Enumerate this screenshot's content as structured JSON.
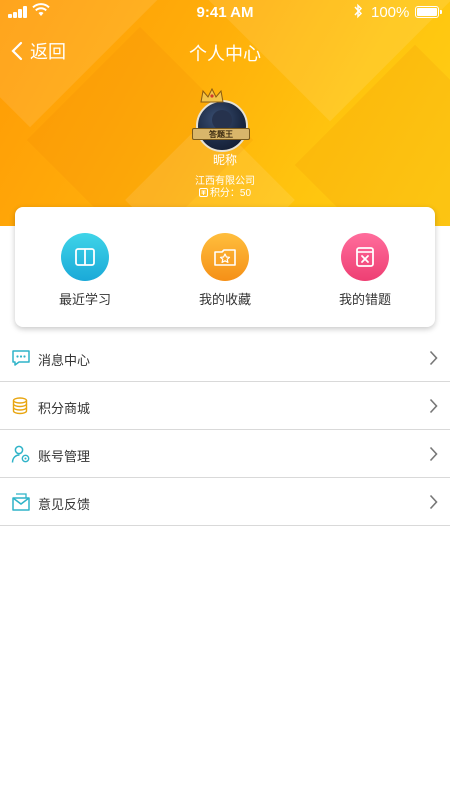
{
  "status_bar": {
    "time": "9:41 AM",
    "battery": "100%"
  },
  "nav": {
    "back_label": "返回",
    "title": "个人中心"
  },
  "profile": {
    "badge_text": "答题王",
    "nickname": "昵称",
    "company": "江西有限公司",
    "points_text": "积分：50"
  },
  "quick_actions": [
    {
      "label": "最近学习",
      "icon": "book-icon",
      "color": "#27bde0"
    },
    {
      "label": "我的收藏",
      "icon": "star-folder-icon",
      "color": "#f7a022"
    },
    {
      "label": "我的错题",
      "icon": "wrong-book-icon",
      "color": "#f2527f"
    }
  ],
  "menu": [
    {
      "label": "消息中心",
      "icon": "message-icon"
    },
    {
      "label": "积分商城",
      "icon": "coins-icon"
    },
    {
      "label": "账号管理",
      "icon": "account-settings-icon"
    },
    {
      "label": "意见反馈",
      "icon": "feedback-mail-icon"
    }
  ],
  "colors": {
    "header_start": "#ff9a05",
    "header_end": "#ffd016",
    "icon_teal": "#2fb3c8",
    "icon_gold": "#e8a50f"
  }
}
